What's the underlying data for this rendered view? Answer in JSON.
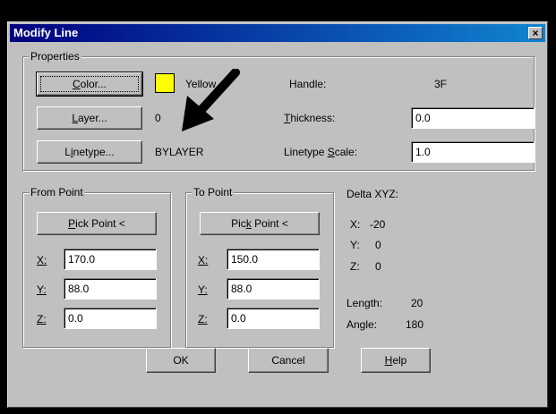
{
  "window": {
    "title": "Modify Line",
    "close_glyph": "×"
  },
  "properties": {
    "legend": "Properties",
    "color_button": {
      "prefix": "",
      "mnemonic": "C",
      "rest": "olor..."
    },
    "color_value": "Yellow",
    "color_swatch": "#ffff00",
    "layer_button": {
      "prefix": "",
      "mnemonic": "L",
      "rest": "ayer..."
    },
    "layer_value": "0",
    "linetype_button": {
      "prefix": "L",
      "mnemonic": "i",
      "rest": "netype..."
    },
    "linetype_value": "BYLAYER",
    "handle_label": "Handle:",
    "handle_value": "3F",
    "thickness_label": {
      "prefix": "",
      "mnemonic": "T",
      "rest": "hickness:"
    },
    "thickness_value": "0.0",
    "linetype_scale_label": {
      "prefix": "Linetype ",
      "mnemonic": "S",
      "rest": "cale:"
    },
    "linetype_scale_value": "1.0"
  },
  "from_point": {
    "legend": "From Point",
    "pick_button": {
      "prefix": "",
      "mnemonic": "P",
      "rest": "ick Point <"
    },
    "x_label": "X:",
    "x_value": "170.0",
    "y_label": "Y:",
    "y_value": "88.0",
    "z_label": "Z:",
    "z_value": "0.0"
  },
  "to_point": {
    "legend": "To Point",
    "pick_button": {
      "prefix": "Pic",
      "mnemonic": "k",
      "rest": " Point <"
    },
    "x_label": "X:",
    "x_value": "150.0",
    "y_label": "Y:",
    "y_value": "88.0",
    "z_label": "Z:",
    "z_value": "0.0"
  },
  "delta": {
    "title": "Delta XYZ:",
    "x_label": "X:",
    "x_value": "-20",
    "y_label": "Y:",
    "y_value": "0",
    "z_label": "Z:",
    "z_value": "0",
    "length_label": "Length:",
    "length_value": "20",
    "angle_label": "Angle:",
    "angle_value": "180"
  },
  "buttons": {
    "ok": "OK",
    "cancel": "Cancel",
    "help": {
      "prefix": "",
      "mnemonic": "H",
      "rest": "elp"
    }
  },
  "annotation": {
    "arrow_icon": "arrow-pointer-icon"
  }
}
